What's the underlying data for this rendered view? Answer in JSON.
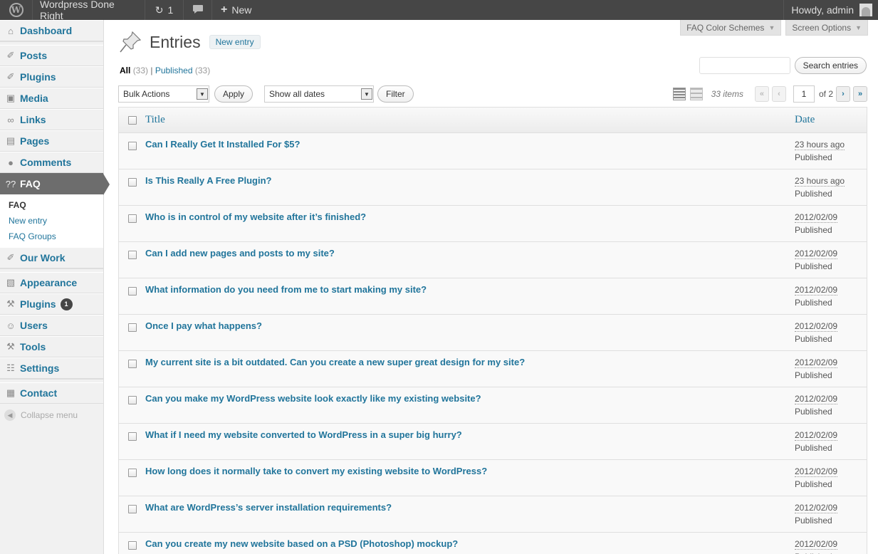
{
  "adminbar": {
    "site_name": "Wordpress Done Right",
    "updates_count": "1",
    "new_label": "New",
    "howdy": "Howdy, admin"
  },
  "sidebar": {
    "items": [
      {
        "label": "Dashboard",
        "icon": "dashboard-icon"
      },
      {
        "label": "Posts",
        "icon": "pin-icon"
      },
      {
        "label": "Plugins",
        "icon": "pin-icon"
      },
      {
        "label": "Media",
        "icon": "media-icon"
      },
      {
        "label": "Links",
        "icon": "link-icon"
      },
      {
        "label": "Pages",
        "icon": "pages-icon"
      },
      {
        "label": "Comments",
        "icon": "comment-icon"
      },
      {
        "label": "FAQ",
        "icon": "faq-icon"
      },
      {
        "label": "Our Work",
        "icon": "pin-icon"
      },
      {
        "label": "Appearance",
        "icon": "appearance-icon"
      },
      {
        "label": "Plugins",
        "icon": "plugin-icon",
        "badge": "1"
      },
      {
        "label": "Users",
        "icon": "users-icon"
      },
      {
        "label": "Tools",
        "icon": "tools-icon"
      },
      {
        "label": "Settings",
        "icon": "settings-icon"
      },
      {
        "label": "Contact",
        "icon": "contact-icon"
      }
    ],
    "faq_submenu": [
      "FAQ",
      "New entry",
      "FAQ Groups"
    ],
    "collapse_label": "Collapse menu"
  },
  "screen_tabs": {
    "color_schemes": "FAQ Color Schemes",
    "screen_options": "Screen Options"
  },
  "page": {
    "title": "Entries",
    "add_new": "New entry"
  },
  "filters": {
    "all_label": "All",
    "all_count": "(33)",
    "published_label": "Published",
    "published_count": "(33)"
  },
  "search": {
    "button": "Search entries"
  },
  "tablenav": {
    "bulk_actions": "Bulk Actions",
    "apply": "Apply",
    "dates": "Show all dates",
    "filter": "Filter",
    "items_count": "33 items",
    "first": "«",
    "prev": "‹",
    "current_page": "1",
    "of_pages": "of 2",
    "next": "›",
    "last": "»"
  },
  "table": {
    "col_title": "Title",
    "col_date": "Date",
    "rows": [
      {
        "title": "Can I Really Get It Installed For $5?",
        "date": "23 hours ago",
        "status": "Published"
      },
      {
        "title": "Is This Really A Free Plugin?",
        "date": "23 hours ago",
        "status": "Published"
      },
      {
        "title": "Who is in control of my website after it’s finished?",
        "date": "2012/02/09",
        "status": "Published"
      },
      {
        "title": "Can I add new pages and posts to my site?",
        "date": "2012/02/09",
        "status": "Published"
      },
      {
        "title": "What information do you need from me to start making my site?",
        "date": "2012/02/09",
        "status": "Published"
      },
      {
        "title": "Once I pay what happens?",
        "date": "2012/02/09",
        "status": "Published"
      },
      {
        "title": "My current site is a bit outdated. Can you create a new super great design for my site?",
        "date": "2012/02/09",
        "status": "Published"
      },
      {
        "title": "Can you make my WordPress website look exactly like my existing website?",
        "date": "2012/02/09",
        "status": "Published"
      },
      {
        "title": "What if I need my website converted to WordPress in a super big hurry?",
        "date": "2012/02/09",
        "status": "Published"
      },
      {
        "title": "How long does it normally take to convert my existing website to WordPress?",
        "date": "2012/02/09",
        "status": "Published"
      },
      {
        "title": "What are WordPress’s server installation requirements?",
        "date": "2012/02/09",
        "status": "Published"
      },
      {
        "title": "Can you create my new website based on a PSD (Photoshop) mockup?",
        "date": "2012/02/09",
        "status": "Published"
      }
    ]
  }
}
